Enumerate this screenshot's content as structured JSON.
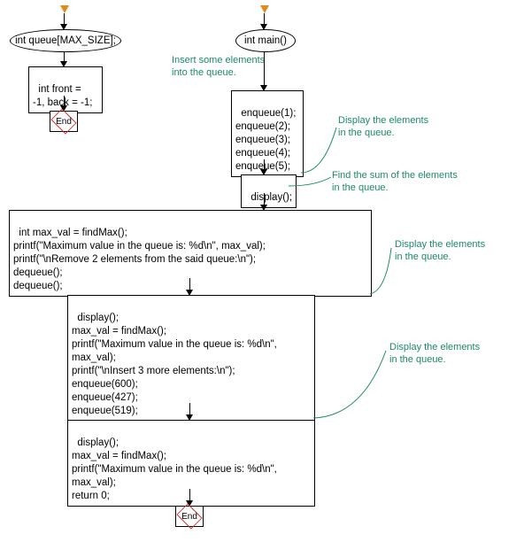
{
  "left": {
    "ellipse": "int queue[MAX_SIZE];",
    "decl": "int front = \n-1, back = -1;",
    "end": "End"
  },
  "right": {
    "ellipse": "int main()",
    "annot1": "Insert some elements\ninto the queue.",
    "box1": "enqueue(1);\nenqueue(2);\nenqueue(3);\nenqueue(4);\nenqueue(5);",
    "annot2": "Display the elements\nin the queue.",
    "box2": "display();",
    "annot3": "Find the sum of the elements\nin the queue.",
    "box3": "int max_val = findMax();\nprintf(\"Maximum value in the queue is: %d\\n\", max_val);\nprintf(\"\\nRemove 2 elements from the said queue:\\n\");\ndequeue();\ndequeue();",
    "annot4": "Display the elements\nin the queue.",
    "box4": "display();\nmax_val = findMax();\nprintf(\"Maximum value in the queue is: %d\\n\", \nmax_val);\nprintf(\"\\nInsert 3 more elements:\\n\");\nenqueue(600);\nenqueue(427);\nenqueue(519);",
    "annot5": "Display the elements\nin the queue.",
    "box5": "display();\nmax_val = findMax();\nprintf(\"Maximum value in the queue is: %d\\n\", \nmax_val);\nreturn 0;",
    "end": "End"
  }
}
